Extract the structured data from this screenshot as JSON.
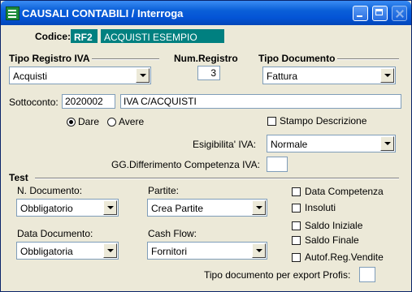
{
  "window": {
    "title": "CAUSALI CONTABILI / Interroga"
  },
  "codice": {
    "label": "Codice:",
    "code": "RF2",
    "description": "ACQUISTI ESEMPIO"
  },
  "tipo_registro": {
    "header": "Tipo Registro IVA",
    "value": "Acquisti"
  },
  "num_registro": {
    "header": "Num.Registro",
    "value": "3"
  },
  "tipo_documento": {
    "header": "Tipo Documento",
    "value": "Fattura"
  },
  "sottoconto": {
    "label": "Sottoconto:",
    "code": "2020002",
    "description": "IVA C/ACQUISTI"
  },
  "dare_avere": {
    "dare_label": "Dare",
    "avere_label": "Avere",
    "selected": "Dare"
  },
  "stampo_descrizione": {
    "label": "Stampo Descrizione",
    "checked": false
  },
  "esigibilita": {
    "label": "Esigibilita' IVA:",
    "value": "Normale"
  },
  "gg_differimento": {
    "label": "GG.Differimento Competenza IVA:",
    "value": ""
  },
  "test": {
    "header": "Test",
    "n_documento": {
      "label": "N. Documento:",
      "value": "Obbligatorio"
    },
    "partite": {
      "label": "Partite:",
      "value": "Crea Partite"
    },
    "data_documento": {
      "label": "Data Documento:",
      "value": "Obbligatoria"
    },
    "cash_flow": {
      "label": "Cash Flow:",
      "value": "Fornitori"
    },
    "checkboxes": {
      "data_competenza": {
        "label": "Data Competenza",
        "checked": false
      },
      "insoluti": {
        "label": "Insoluti",
        "checked": false
      },
      "saldo_iniziale": {
        "label": "Saldo Iniziale",
        "checked": false
      },
      "saldo_finale": {
        "label": "Saldo Finale",
        "checked": false
      },
      "autof_reg_vendite": {
        "label": "Autof.Reg.Vendite",
        "checked": false
      }
    },
    "tipo_doc_export": {
      "label": "Tipo documento per export Profis:",
      "value": ""
    }
  }
}
